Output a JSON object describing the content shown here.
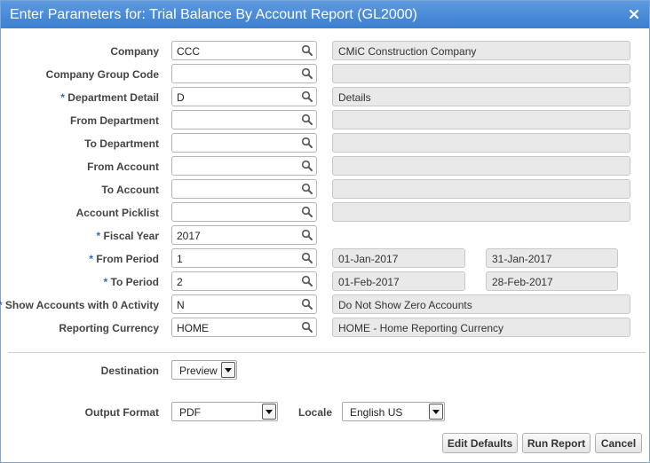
{
  "dialog": {
    "title": "Enter Parameters for: Trial Balance By Account Report (GL2000)",
    "colors": {
      "title_bar": "#3d7fd0",
      "required_marker": "#2e6bc2",
      "readonly_bg": "#e9e9e9"
    }
  },
  "fields": [
    {
      "label": "Company",
      "required": false,
      "value": "CCC",
      "description": "CMiC Construction Company"
    },
    {
      "label": "Company Group Code",
      "required": false,
      "value": "",
      "description": ""
    },
    {
      "label": "Department Detail",
      "required": true,
      "value": "D",
      "description": "Details"
    },
    {
      "label": "From Department",
      "required": false,
      "value": "",
      "description": ""
    },
    {
      "label": "To Department",
      "required": false,
      "value": "",
      "description": ""
    },
    {
      "label": "From Account",
      "required": false,
      "value": "",
      "description": ""
    },
    {
      "label": "To Account",
      "required": false,
      "value": "",
      "description": ""
    },
    {
      "label": "Account Picklist",
      "required": false,
      "value": "",
      "description": ""
    },
    {
      "label": "Fiscal Year",
      "required": true,
      "value": "2017"
    },
    {
      "label": "From Period",
      "required": true,
      "value": "1",
      "start_date": "01-Jan-2017",
      "end_date": "31-Jan-2017"
    },
    {
      "label": "To Period",
      "required": true,
      "value": "2",
      "start_date": "01-Feb-2017",
      "end_date": "28-Feb-2017"
    },
    {
      "label": "Show Accounts with 0 Activity",
      "required": true,
      "value": "N",
      "description": "Do Not Show Zero Accounts"
    },
    {
      "label": "Reporting Currency",
      "required": false,
      "value": "HOME",
      "description": "HOME - Home Reporting Currency"
    }
  ],
  "required_marker": "*",
  "output": {
    "destination_label": "Destination",
    "destination_value": "Preview",
    "format_label": "Output Format",
    "format_value": "PDF",
    "locale_label": "Locale",
    "locale_value": "English US"
  },
  "buttons": {
    "edit_defaults": "Edit Defaults",
    "run_report": "Run Report",
    "cancel": "Cancel"
  },
  "icons": {
    "close": "close-icon",
    "lookup": "search-icon",
    "dropdown": "chevron-down-icon"
  }
}
